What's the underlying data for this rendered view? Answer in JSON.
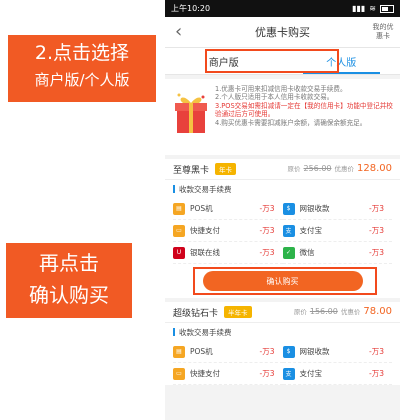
{
  "status_bar": {
    "time": "上午10:20",
    "signal": "▮▮▮",
    "wifi": "≋"
  },
  "nav": {
    "back_icon": "chevron-left",
    "title": "优惠卡购买",
    "mine_label": "我的优惠卡"
  },
  "tabs": [
    {
      "label": "商户版",
      "active": false
    },
    {
      "label": "个人版",
      "active": true
    }
  ],
  "notice": {
    "lines": [
      {
        "text": "1.优惠卡可用来扣减信用卡收款交易手续费。",
        "warn": false
      },
      {
        "text": "2.个人版只适用于本人信用卡收款交易。",
        "warn": false
      },
      {
        "text": "3.POS交易如需扣减请一定在【我的信用卡】功能中登记并校验通过后方可使用。",
        "warn": true
      },
      {
        "text": "4.购买优惠卡需要扣减账户余额，请确保余额充足。",
        "warn": false
      }
    ]
  },
  "cards": [
    {
      "name": "至尊黑卡",
      "badge": "年卡",
      "orig_label": "原价",
      "orig_price": "256.00",
      "cur_label": "优惠价",
      "cur_price": "128.00",
      "fee_title": "收款交易手续费",
      "fees": [
        {
          "name": "POS机",
          "value": "-万3",
          "icon": "pos-icon",
          "color": "#f5a623",
          "glyph": "▤"
        },
        {
          "name": "网银收款",
          "value": "-万3",
          "icon": "bank-icon",
          "color": "#1a8fe3",
          "glyph": "$"
        },
        {
          "name": "快捷支付",
          "value": "-万3",
          "icon": "card-icon",
          "color": "#f5a623",
          "glyph": "▭"
        },
        {
          "name": "支付宝",
          "value": "-万3",
          "icon": "alipay-icon",
          "color": "#1a8fe3",
          "glyph": "支"
        },
        {
          "name": "银联在线",
          "value": "-万3",
          "icon": "unionpay-icon",
          "color": "#d0021b",
          "glyph": "U"
        },
        {
          "name": "微信",
          "value": "-万3",
          "icon": "wechat-icon",
          "color": "#2db34a",
          "glyph": "✓"
        }
      ],
      "buy_label": "确认购买"
    },
    {
      "name": "超级钻石卡",
      "badge": "半年卡",
      "orig_label": "原价",
      "orig_price": "156.00",
      "cur_label": "优惠价",
      "cur_price": "78.00",
      "fee_title": "收款交易手续费",
      "fees": [
        {
          "name": "POS机",
          "value": "-万3",
          "icon": "pos-icon",
          "color": "#f5a623",
          "glyph": "▤"
        },
        {
          "name": "网银收款",
          "value": "-万3",
          "icon": "bank-icon",
          "color": "#1a8fe3",
          "glyph": "$"
        },
        {
          "name": "快捷支付",
          "value": "-万3",
          "icon": "card-icon",
          "color": "#f5a623",
          "glyph": "▭"
        },
        {
          "name": "支付宝",
          "value": "-万3",
          "icon": "alipay-icon",
          "color": "#1a8fe3",
          "glyph": "支"
        }
      ]
    }
  ],
  "annotations": {
    "step1": {
      "line1": "2.点击选择",
      "line2": "商户版/个人版"
    },
    "step2": {
      "line1": "再点击",
      "line2": "确认购买"
    }
  },
  "colors": {
    "accent": "#f26522",
    "blue": "#1a8fe3",
    "annotation": "#f15a24"
  }
}
